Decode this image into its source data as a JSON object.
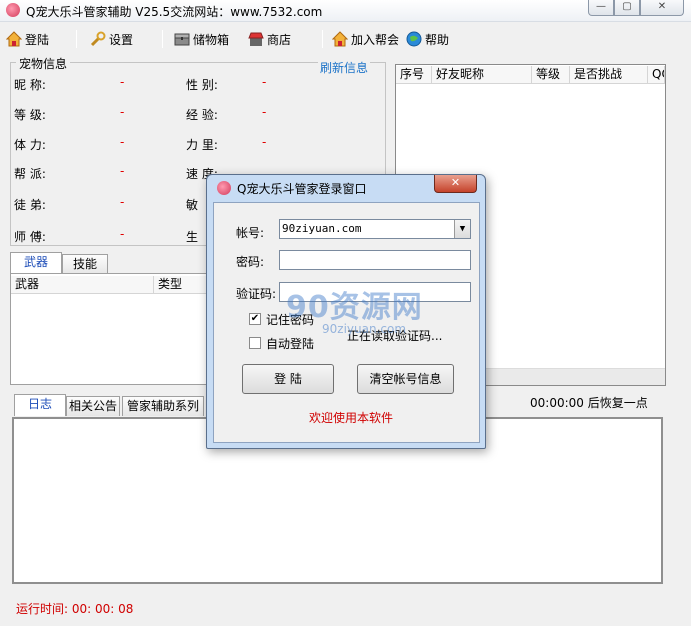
{
  "window": {
    "title": "Q宠大乐斗管家辅助 V25.5交流网站：www.7532.com",
    "min_icon": "minimize-icon",
    "max_icon": "maximize-icon",
    "close_icon": "close-icon"
  },
  "toolbar": {
    "login": "登陆",
    "settings": "设置",
    "storage": "储物箱",
    "shop": "商店",
    "join_clan": "加入帮会",
    "help": "帮助"
  },
  "pet_info": {
    "legend": "宠物信息",
    "refresh": "刷新信息",
    "left_labels": [
      "昵 称:",
      "等 级:",
      "体 力:",
      "帮 派:",
      "徒 弟:",
      "师 傅:"
    ],
    "right_labels": [
      "性 别:",
      "经 验:",
      "力 里:",
      "速 度:",
      "敏",
      "生"
    ],
    "placeholder_value": "-"
  },
  "item_tabs": {
    "weapons": "武器",
    "skills": "技能",
    "col_weapon": "武器",
    "col_type": "类型"
  },
  "friend_list": {
    "columns": [
      "序号",
      "好友昵称",
      "等级",
      "是否挑战",
      "QQ"
    ]
  },
  "log_tabs": {
    "log": "日志",
    "notice": "相关公告",
    "series": "管家辅助系列"
  },
  "restore_text": "00:00:00 后恢复一点",
  "runtime": "运行时间: 00: 00: 08",
  "login_dialog": {
    "title": "Q宠大乐斗管家登录窗口",
    "account_label": "帐号:",
    "account_value": "90ziyuan.com",
    "password_label": "密码:",
    "password_value": "",
    "captcha_label": "验证码:",
    "captcha_value": "",
    "remember_label": "记住密码",
    "remember_checked": true,
    "auto_login_label": "自动登陆",
    "auto_login_checked": false,
    "reading_captcha": "正在读取验证码...",
    "login_button": "登 陆",
    "clear_button": "清空帐号信息",
    "welcome": "欢迎使用本软件"
  },
  "watermark": {
    "main": "90资源网",
    "sub": "90ziyuan.com"
  }
}
